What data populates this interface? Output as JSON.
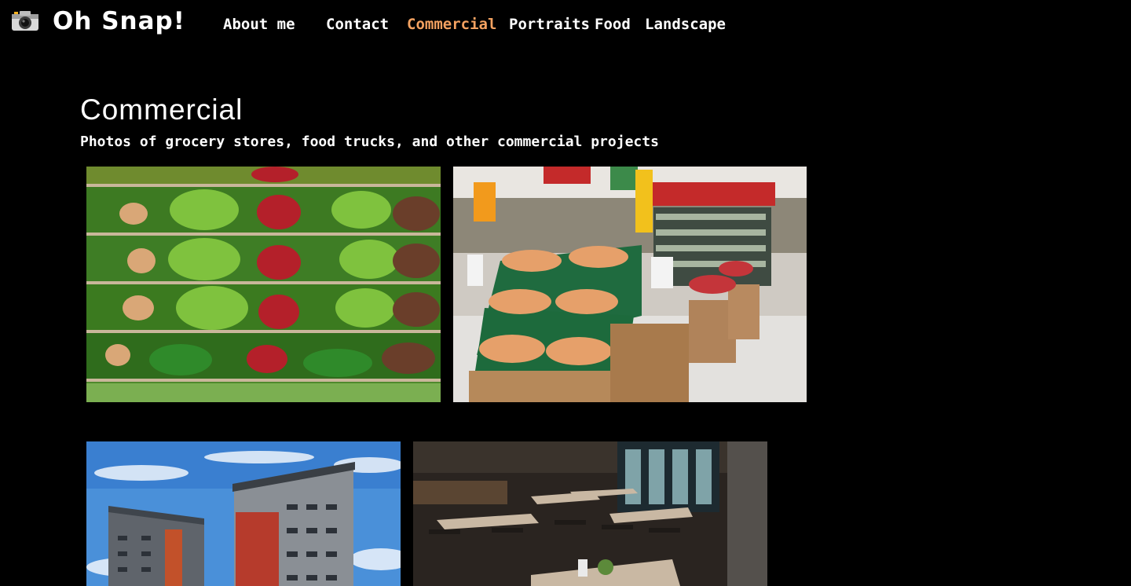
{
  "site": {
    "title": "Oh Snap!",
    "logo_icon": "camera-icon"
  },
  "nav": [
    {
      "label": "About me",
      "active": false
    },
    {
      "label": "Contact",
      "active": false
    },
    {
      "label": "Commercial",
      "active": true
    },
    {
      "label": "Portraits",
      "active": false
    },
    {
      "label": "Food",
      "active": false
    },
    {
      "label": "Landscape",
      "active": false
    }
  ],
  "colors": {
    "background": "#000000",
    "text": "#ffffff",
    "accent": "#f4a261"
  },
  "page": {
    "title": "Commercial",
    "subtitle": "Photos of grocery stores, food trucks, and other commercial projects"
  },
  "gallery": [
    {
      "subject": "produce-shelves"
    },
    {
      "subject": "supermarket-aisle"
    },
    {
      "subject": "apartment-building"
    },
    {
      "subject": "restaurant-interior"
    }
  ]
}
